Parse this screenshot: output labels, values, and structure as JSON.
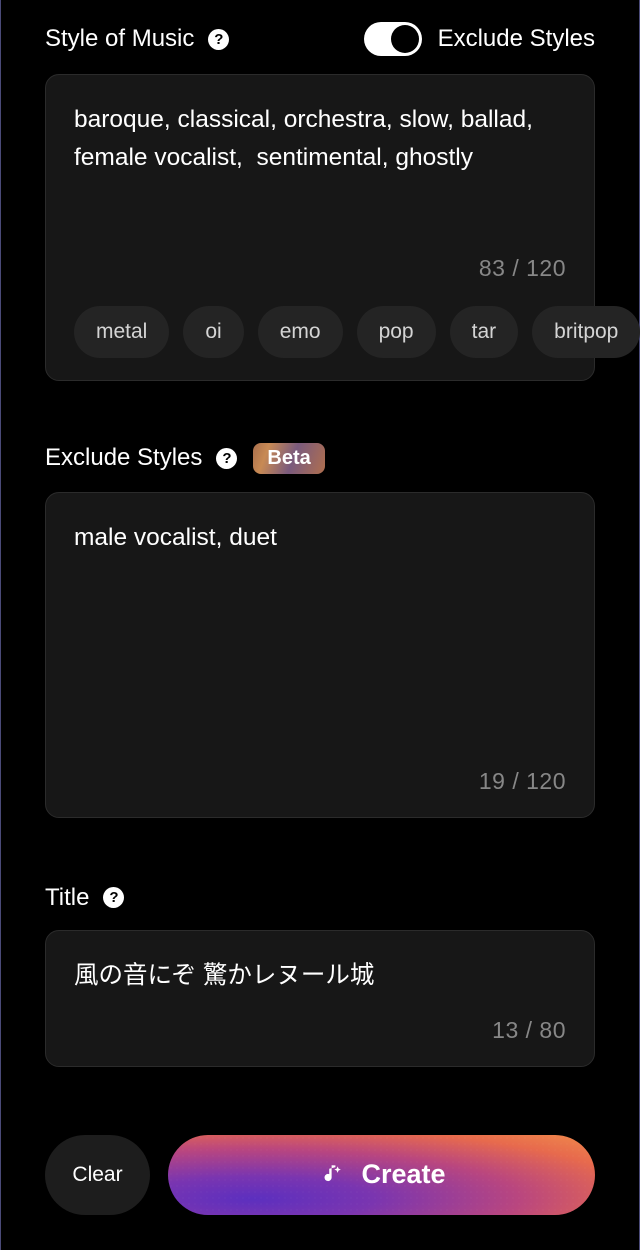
{
  "style": {
    "label": "Style of Music",
    "toggle_label": "Exclude Styles",
    "value": "baroque, classical, orchestra, slow, ballad, female vocalist,  sentimental, ghostly",
    "counter": "83 / 120",
    "chips": [
      "metal",
      "oi",
      "emo",
      "pop",
      "tar",
      "britpop"
    ]
  },
  "exclude": {
    "label": "Exclude Styles",
    "badge": "Beta",
    "value": "male vocalist, duet",
    "counter": "19 / 120"
  },
  "title": {
    "label": "Title",
    "value": "風の音にぞ 驚かレヌール城",
    "counter": "13 / 80"
  },
  "footer": {
    "clear": "Clear",
    "create": "Create"
  }
}
